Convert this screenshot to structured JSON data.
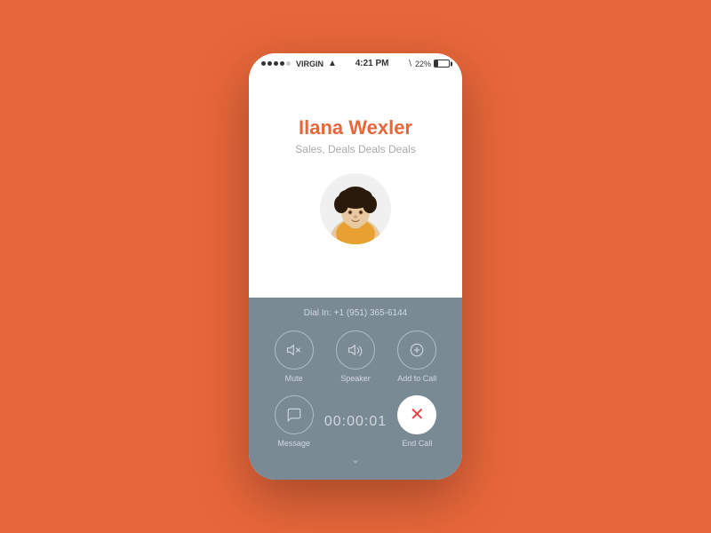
{
  "statusBar": {
    "carrier": "VIRGIN",
    "time": "4:21 PM",
    "battery": "22%"
  },
  "contact": {
    "name": "Ilana Wexler",
    "title": "Sales, Deals Deals Deals"
  },
  "call": {
    "dialIn": "Dial In: +1 (951) 365-6144",
    "timer": "00:00:01"
  },
  "controls": {
    "mute": {
      "label": "Mute"
    },
    "speaker": {
      "label": "Speaker"
    },
    "addToCall": {
      "label": "Add to Call"
    },
    "message": {
      "label": "Message"
    },
    "endCall": {
      "label": "End Call"
    }
  },
  "chevron": "⌄"
}
